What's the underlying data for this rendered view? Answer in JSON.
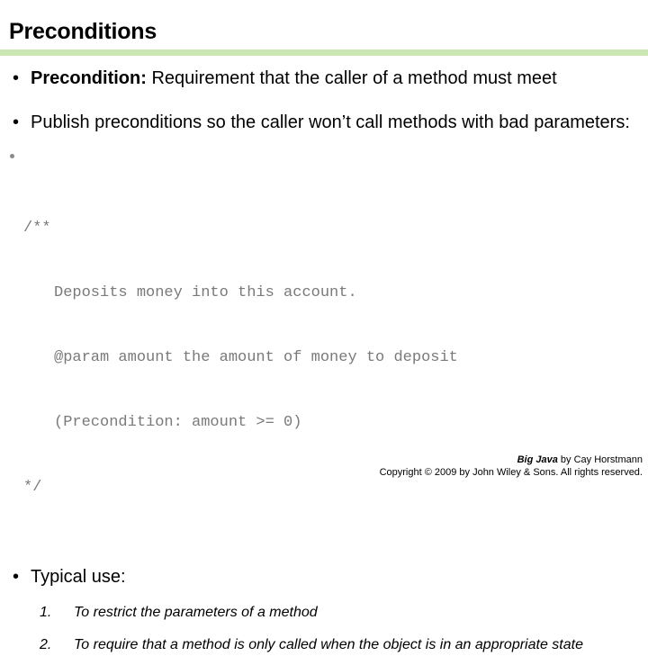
{
  "slide": {
    "title": "Preconditions",
    "rule_color": "#cbe5b3"
  },
  "bullets": {
    "precondition": {
      "marker": "•",
      "lead": "Precondition:",
      "rest": " Requirement that the caller of a method must meet"
    },
    "publish": {
      "marker": "•",
      "text": "Publish preconditions so the caller won’t call methods with bad parameters:"
    },
    "typical": {
      "marker": "•",
      "text": "Typical use:"
    }
  },
  "code": {
    "marker": "•",
    "color": "#7a7a7a",
    "lines": [
      "/**",
      "Deposits money into this account.",
      "@param amount the amount of money to deposit",
      "(Precondition: amount >= 0)",
      "*/"
    ]
  },
  "numbered_list": [
    {
      "num": "1.",
      "text": "To restrict the parameters of a method"
    },
    {
      "num": "2.",
      "text": "To require that a method is only called when the object is in an appropriate state"
    }
  ],
  "footer": {
    "book_title": "Big Java",
    "byline": " by Cay Horstmann",
    "copyright": "Copyright © 2009 by John Wiley & Sons.  All rights reserved."
  }
}
